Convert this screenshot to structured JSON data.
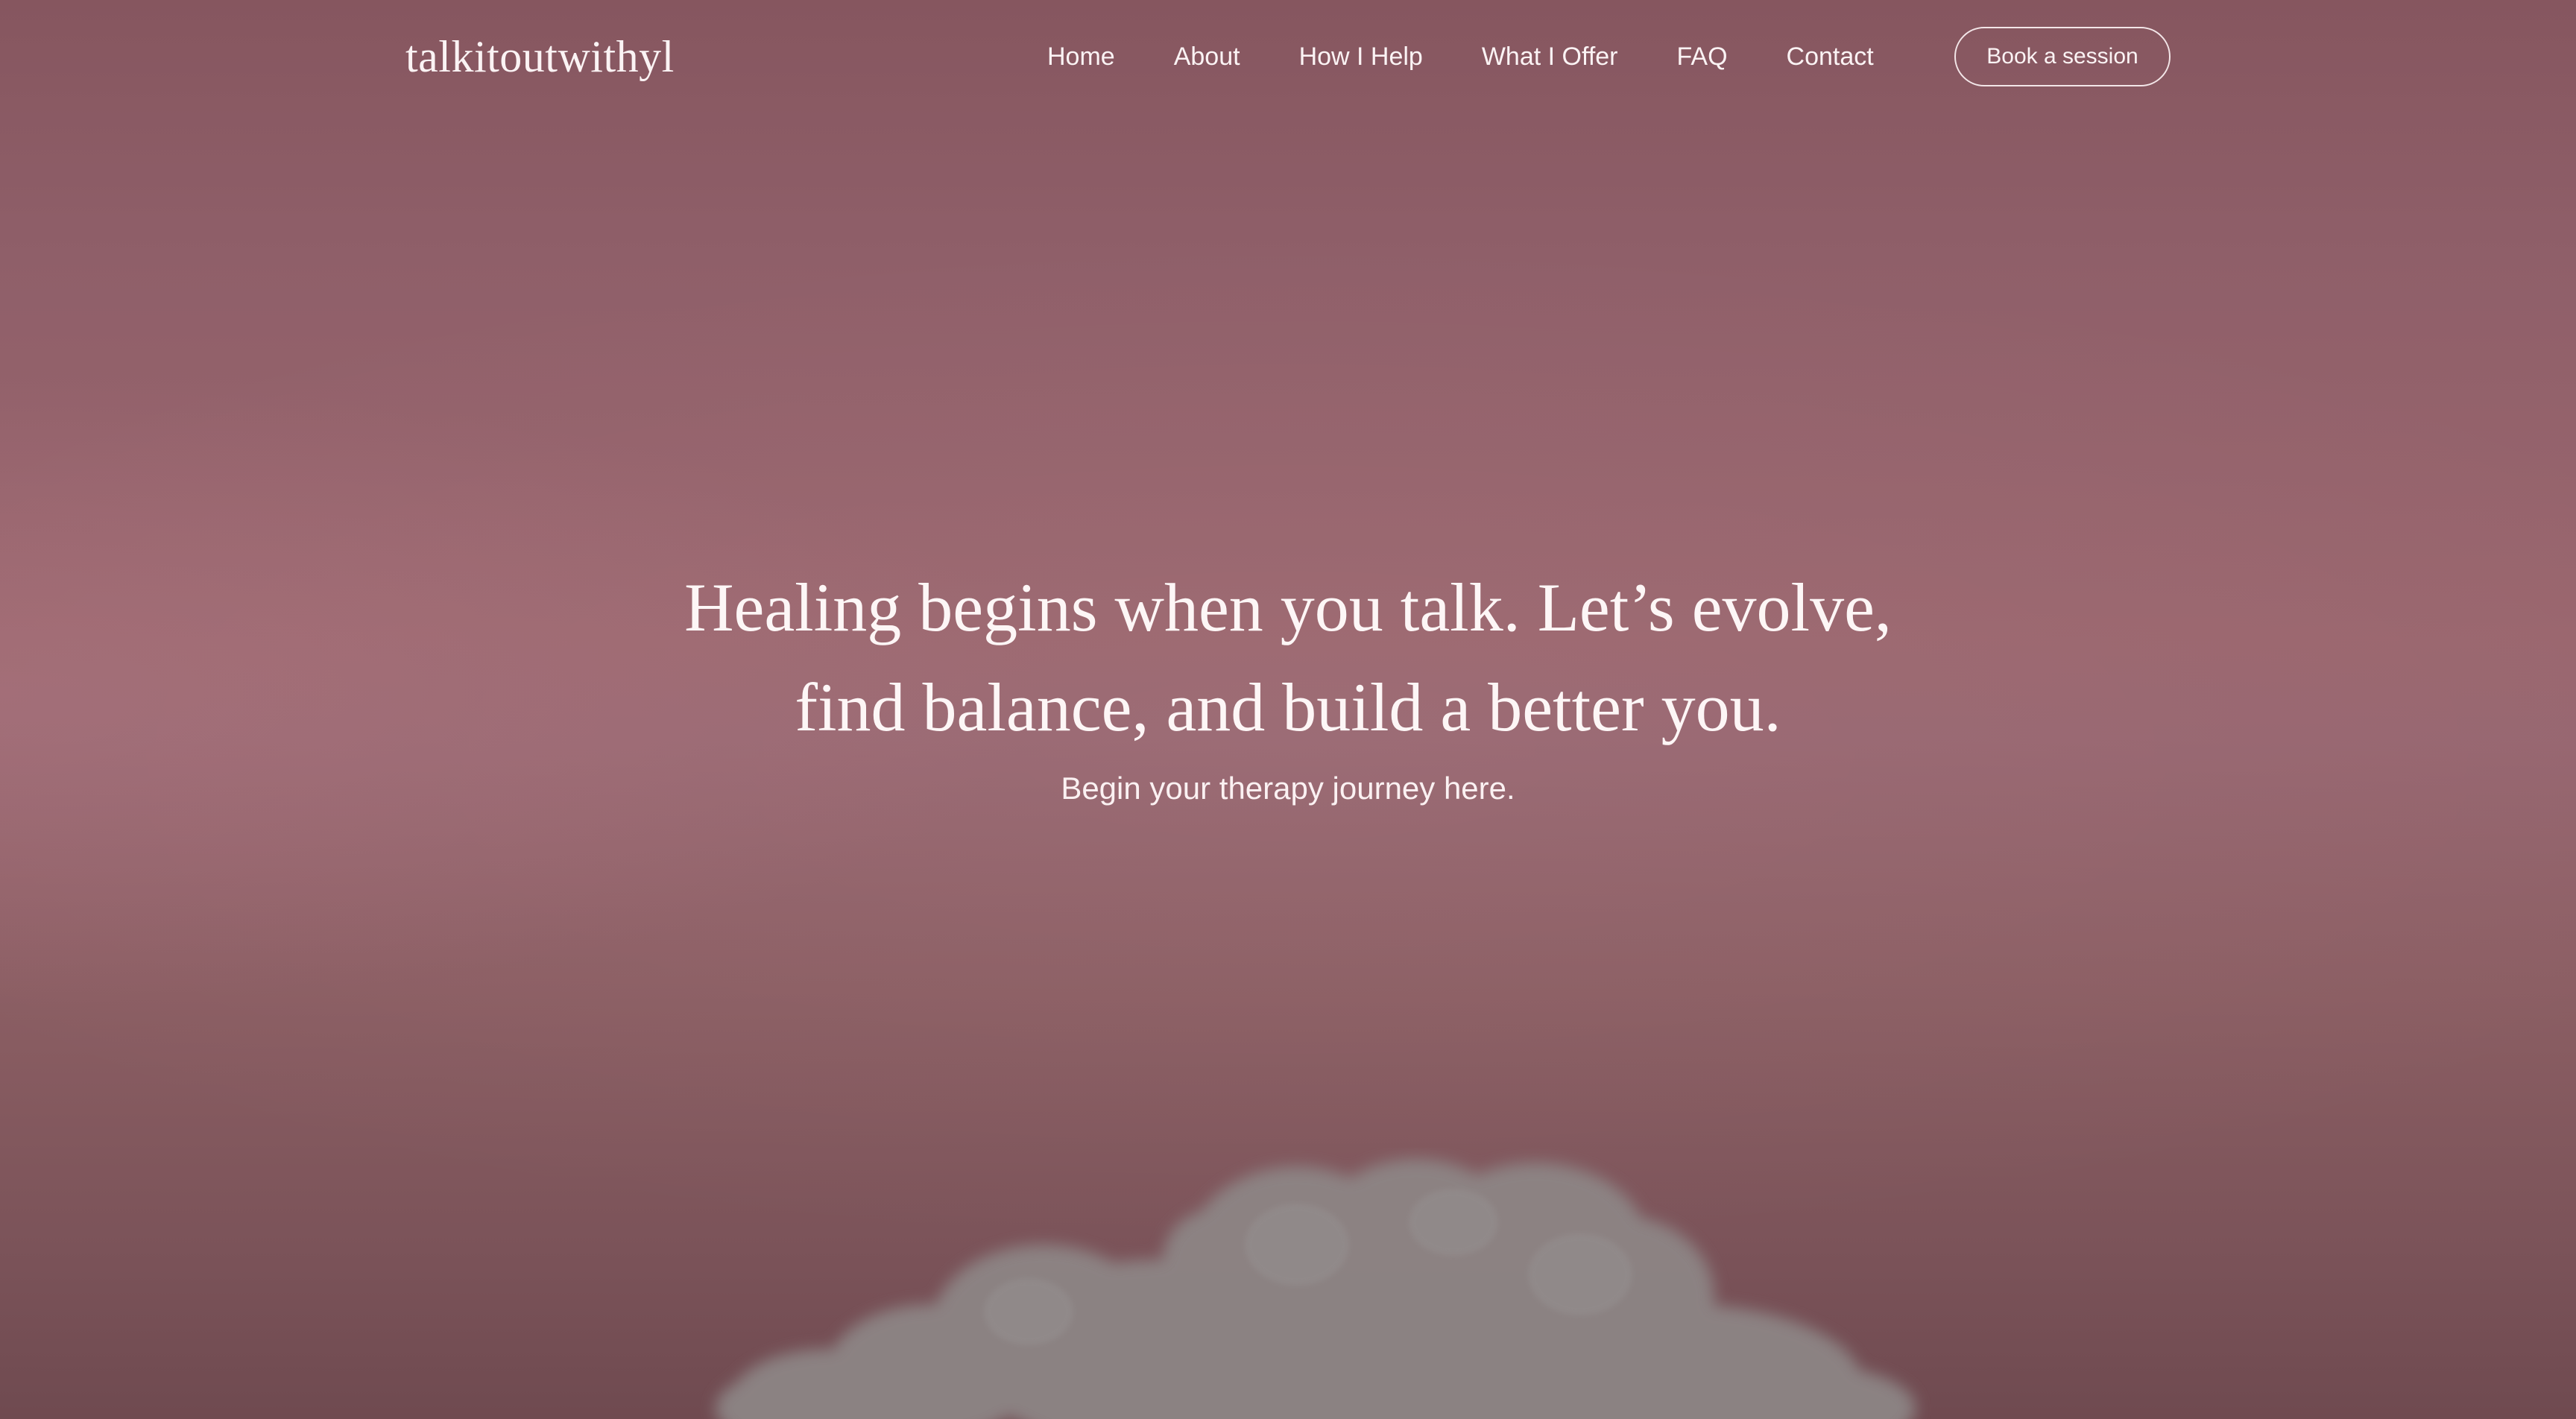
{
  "site": {
    "logo": "talkitoutwithyl"
  },
  "nav": {
    "items": [
      {
        "label": "Home"
      },
      {
        "label": "About"
      },
      {
        "label": "How I Help"
      },
      {
        "label": "What I Offer"
      },
      {
        "label": "FAQ"
      },
      {
        "label": "Contact"
      }
    ],
    "cta_label": "Book a session"
  },
  "hero": {
    "headline_line1": "Healing begins when you talk. Let’s evolve,",
    "headline_line2": "find balance, and build a better you.",
    "subline": "Begin your therapy journey here."
  },
  "colors": {
    "background_top": "#86565f",
    "background_mid": "#9a666e",
    "background_bottom": "#6f4a50",
    "text": "#fdf6f6",
    "cloud": "#8a8282"
  },
  "icons": {
    "background_image": "cloud-image"
  }
}
